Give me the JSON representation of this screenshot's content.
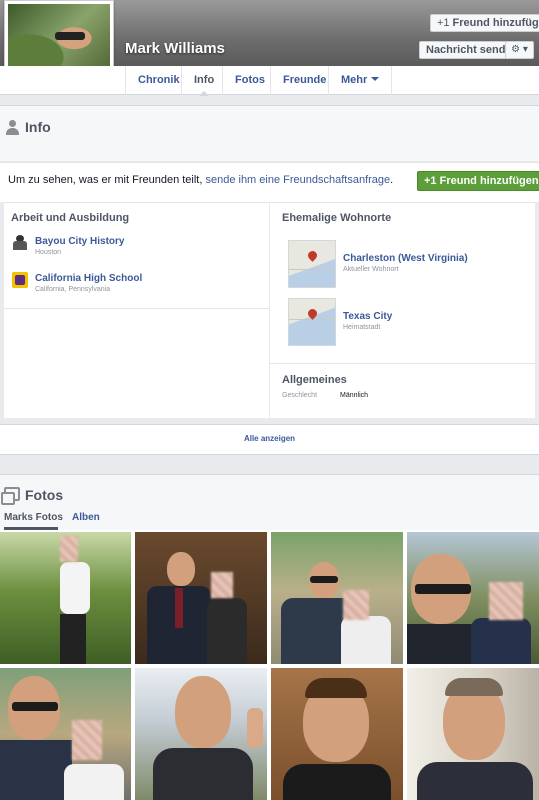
{
  "profile": {
    "name": "Mark Williams",
    "add_friend_label": "Freund hinzufügen",
    "message_label": "Nachricht senden",
    "add_friend_glyph": "+1"
  },
  "tabs": [
    {
      "label": "Chronik",
      "active": false
    },
    {
      "label": "Info",
      "active": true
    },
    {
      "label": "Fotos",
      "active": false
    },
    {
      "label": "Freunde",
      "active": false
    },
    {
      "label": "Mehr",
      "active": false
    }
  ],
  "info": {
    "title": "Info",
    "notice_prefix": "Um zu sehen, was er mit Freunden teilt, ",
    "notice_link": "sende ihm eine Freundschaftsanfrage",
    "notice_suffix": ".",
    "add_friend_label": "Freund hinzufügen"
  },
  "work": {
    "title": "Arbeit und Ausbildung",
    "items": [
      {
        "name": "Bayou City History",
        "detail": "Houston",
        "icon": "briefcase-icon"
      },
      {
        "name": "California High School",
        "detail": "California, Pennsylvania",
        "icon": "school-icon"
      }
    ]
  },
  "places": {
    "title": "Ehemalige Wohnorte",
    "items": [
      {
        "name": "Charleston (West Virginia)",
        "detail": "Aktueller Wohnort"
      },
      {
        "name": "Texas City",
        "detail": "Heimatstadt"
      }
    ]
  },
  "basic": {
    "title": "Allgemeines",
    "gender_key": "Geschlecht",
    "gender_value": "Männlich"
  },
  "show_all_label": "Alle anzeigen",
  "photos": {
    "title": "Fotos",
    "subtabs": [
      {
        "label": "Marks Fotos",
        "active": true
      },
      {
        "label": "Alben",
        "active": false
      }
    ]
  },
  "colors": {
    "link": "#3b5998",
    "green_button": "#5b9e3a",
    "page_bg": "#e9eaed"
  }
}
